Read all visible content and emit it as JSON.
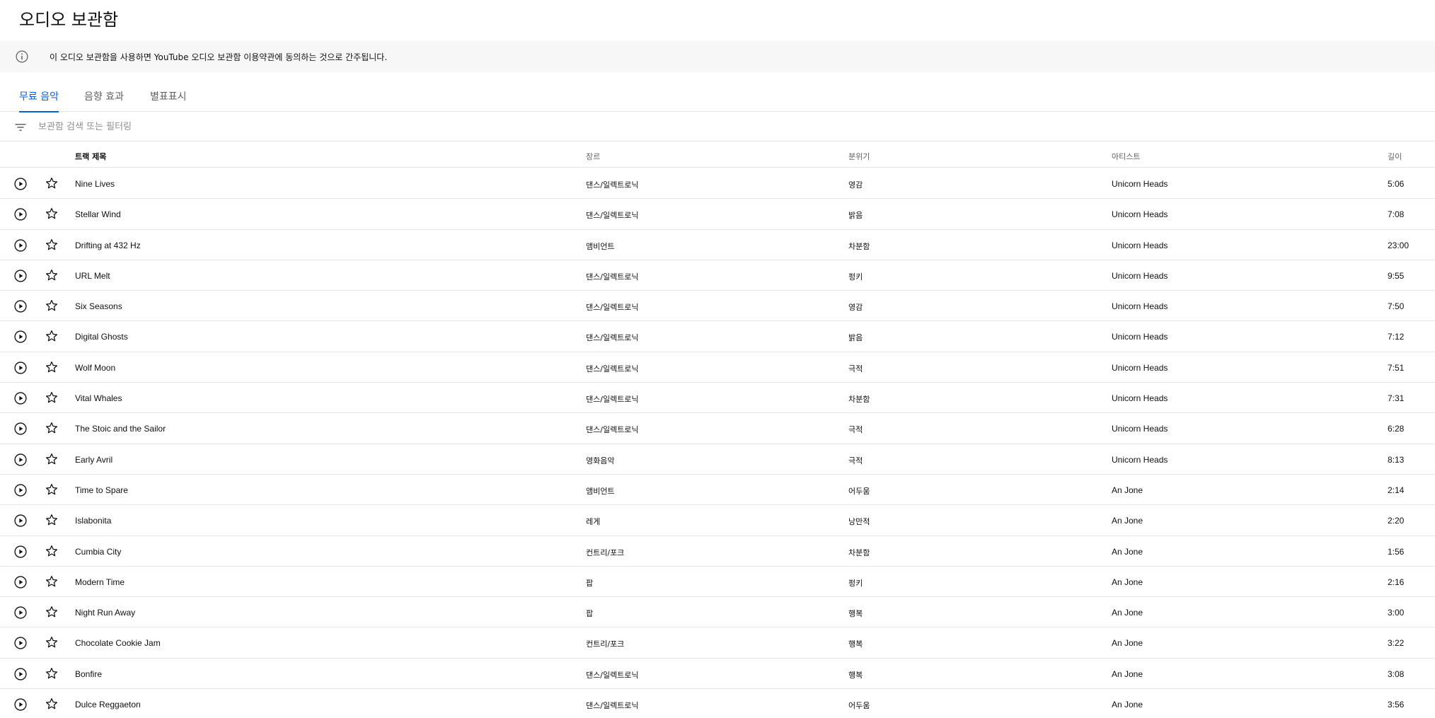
{
  "page": {
    "title": "오디오 보관함"
  },
  "notice": {
    "text": "이 오디오 보관함을 사용하면 YouTube 오디오 보관함 이용약관에 동의하는 것으로 간주됩니다."
  },
  "tabs": [
    {
      "label": "무료 음악",
      "active": true
    },
    {
      "label": "음향 효과",
      "active": false
    },
    {
      "label": "별표표시",
      "active": false
    }
  ],
  "filter": {
    "placeholder": "보관함 검색 또는 필터링",
    "value": ""
  },
  "table": {
    "columns": {
      "title": "트랙 제목",
      "genre": "장르",
      "mood": "분위기",
      "artist": "아티스트",
      "duration": "길이"
    },
    "rows": [
      {
        "title": "Nine Lives",
        "genre": "댄스/일렉트로닉",
        "mood": "영감",
        "artist": "Unicorn Heads",
        "duration": "5:06"
      },
      {
        "title": "Stellar Wind",
        "genre": "댄스/일렉트로닉",
        "mood": "밝음",
        "artist": "Unicorn Heads",
        "duration": "7:08"
      },
      {
        "title": "Drifting at 432 Hz",
        "genre": "앰비언트",
        "mood": "차분함",
        "artist": "Unicorn Heads",
        "duration": "23:00"
      },
      {
        "title": "URL Melt",
        "genre": "댄스/일렉트로닉",
        "mood": "펑키",
        "artist": "Unicorn Heads",
        "duration": "9:55"
      },
      {
        "title": "Six Seasons",
        "genre": "댄스/일렉트로닉",
        "mood": "영감",
        "artist": "Unicorn Heads",
        "duration": "7:50"
      },
      {
        "title": "Digital Ghosts",
        "genre": "댄스/일렉트로닉",
        "mood": "밝음",
        "artist": "Unicorn Heads",
        "duration": "7:12"
      },
      {
        "title": "Wolf Moon",
        "genre": "댄스/일렉트로닉",
        "mood": "극적",
        "artist": "Unicorn Heads",
        "duration": "7:51"
      },
      {
        "title": "Vital Whales",
        "genre": "댄스/일렉트로닉",
        "mood": "차분함",
        "artist": "Unicorn Heads",
        "duration": "7:31"
      },
      {
        "title": "The Stoic and the Sailor",
        "genre": "댄스/일렉트로닉",
        "mood": "극적",
        "artist": "Unicorn Heads",
        "duration": "6:28"
      },
      {
        "title": "Early Avril",
        "genre": "영화음악",
        "mood": "극적",
        "artist": "Unicorn Heads",
        "duration": "8:13"
      },
      {
        "title": "Time to Spare",
        "genre": "앰비언트",
        "mood": "어두움",
        "artist": "An Jone",
        "duration": "2:14"
      },
      {
        "title": "Islabonita",
        "genre": "레게",
        "mood": "낭만적",
        "artist": "An Jone",
        "duration": "2:20"
      },
      {
        "title": "Cumbia City",
        "genre": "컨트리/포크",
        "mood": "차분함",
        "artist": "An Jone",
        "duration": "1:56"
      },
      {
        "title": "Modern Time",
        "genre": "팝",
        "mood": "펑키",
        "artist": "An Jone",
        "duration": "2:16"
      },
      {
        "title": "Night Run Away",
        "genre": "팝",
        "mood": "행복",
        "artist": "An Jone",
        "duration": "3:00"
      },
      {
        "title": "Chocolate Cookie Jam",
        "genre": "컨트리/포크",
        "mood": "행복",
        "artist": "An Jone",
        "duration": "3:22"
      },
      {
        "title": "Bonfire",
        "genre": "댄스/일렉트로닉",
        "mood": "행복",
        "artist": "An Jone",
        "duration": "3:08"
      },
      {
        "title": "Dulce Reggaeton",
        "genre": "댄스/일렉트로닉",
        "mood": "어두움",
        "artist": "An Jone",
        "duration": "3:56"
      }
    ]
  },
  "icons": {
    "notice": "info-icon",
    "filter": "filter-icon",
    "row_play": "play-circle-icon",
    "row_star": "star-outline-icon"
  },
  "colors": {
    "accent": "#065fd4",
    "notice_bg": "#f7f7f7",
    "divider": "#e5e5e5"
  }
}
